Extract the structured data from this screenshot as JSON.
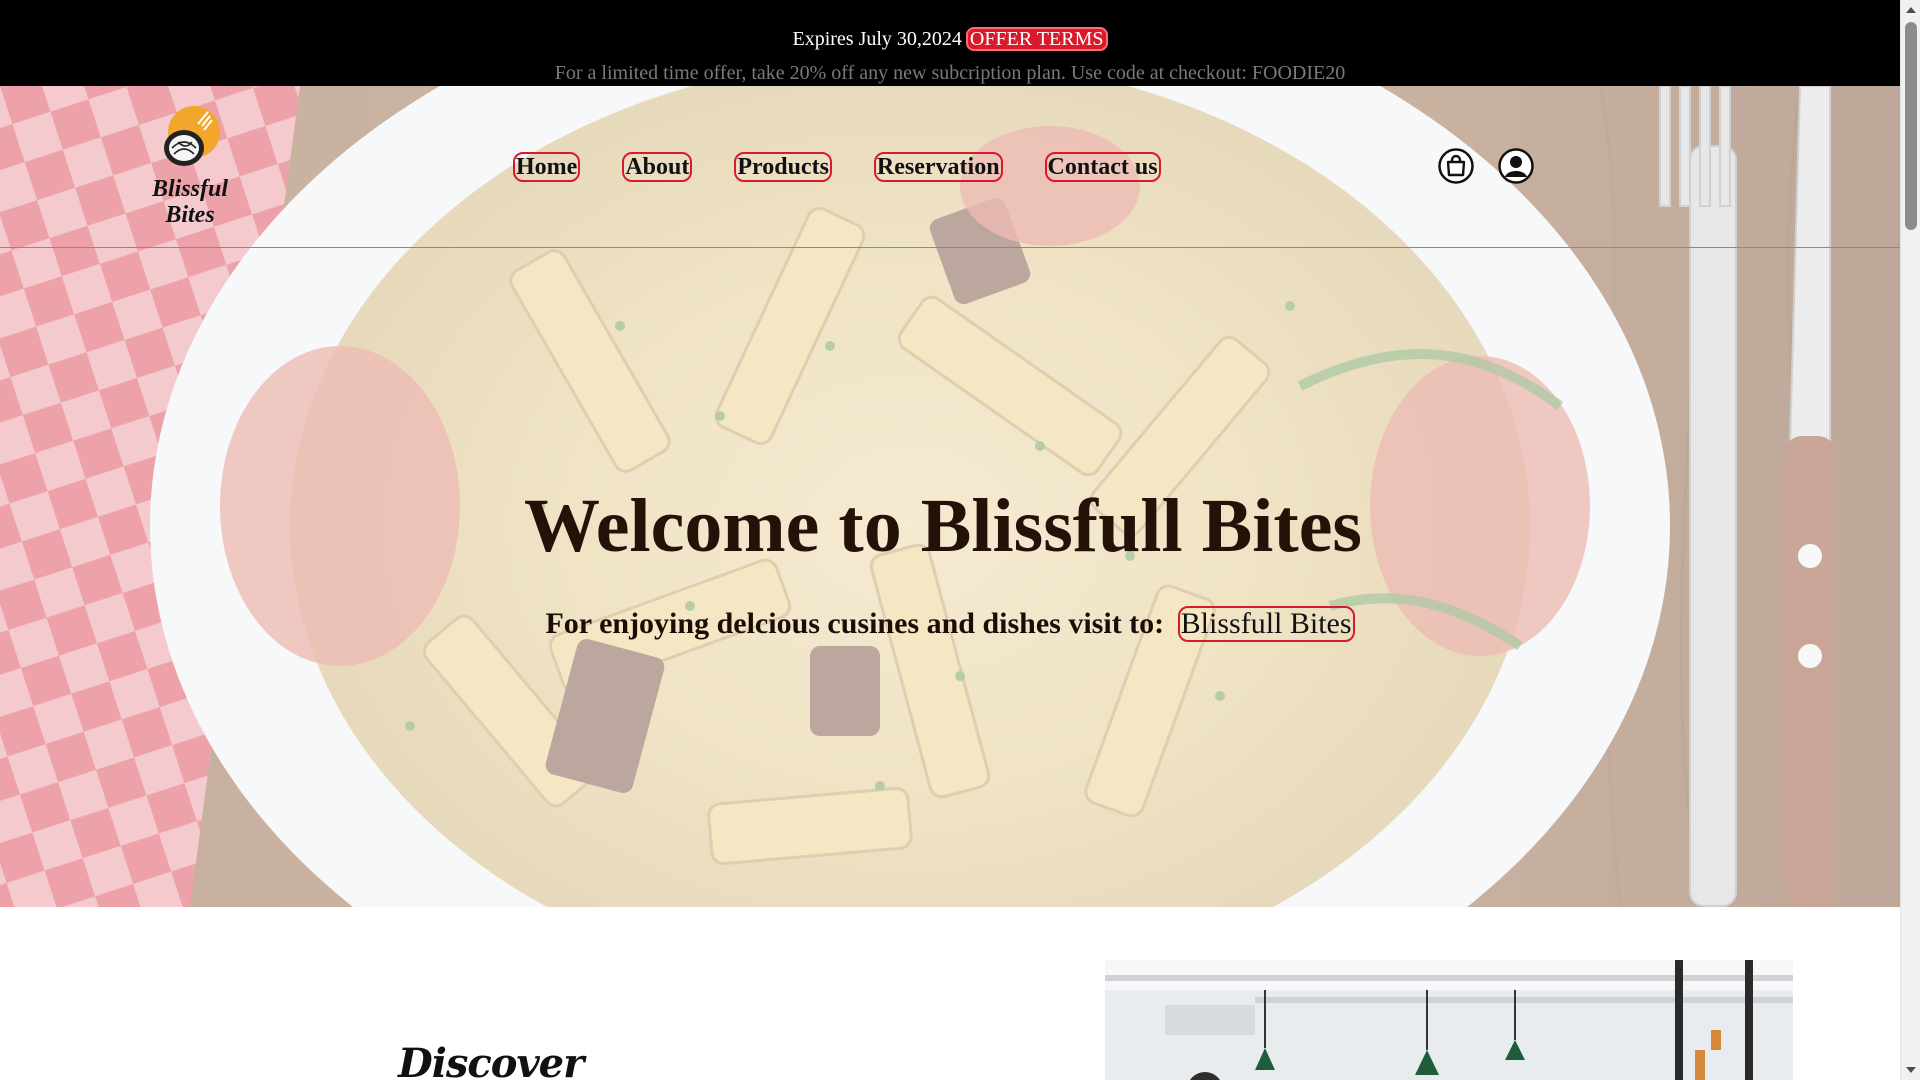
{
  "promo": {
    "expires_text": "Expires July 30,2024",
    "offer_button": "OFFER TERMS",
    "offer_line": "For a limited time offer, take 20% off any new subcription plan. Use code at checkout: FOODIE20"
  },
  "brand": {
    "name": "Blissful Bites",
    "logo_line1": "Blissful",
    "logo_line2": "Bites"
  },
  "nav": {
    "items": [
      {
        "label": "Home"
      },
      {
        "label": "About"
      },
      {
        "label": "Products"
      },
      {
        "label": "Reservation"
      },
      {
        "label": "Contact us"
      }
    ]
  },
  "header_icons": {
    "cart": "shopping-bag-icon",
    "account": "user-account-icon"
  },
  "hero": {
    "title": "Welcome to Blissfull Bites",
    "subtitle": "For enjoying delcious cusines and dishes visit to:",
    "link_label": "Blissfull Bites"
  },
  "section": {
    "heading": "Discover"
  },
  "colors": {
    "accent": "#d81b2a",
    "promo_bg": "#000000",
    "title": "#241208",
    "logo_orange": "#f2a62b"
  }
}
